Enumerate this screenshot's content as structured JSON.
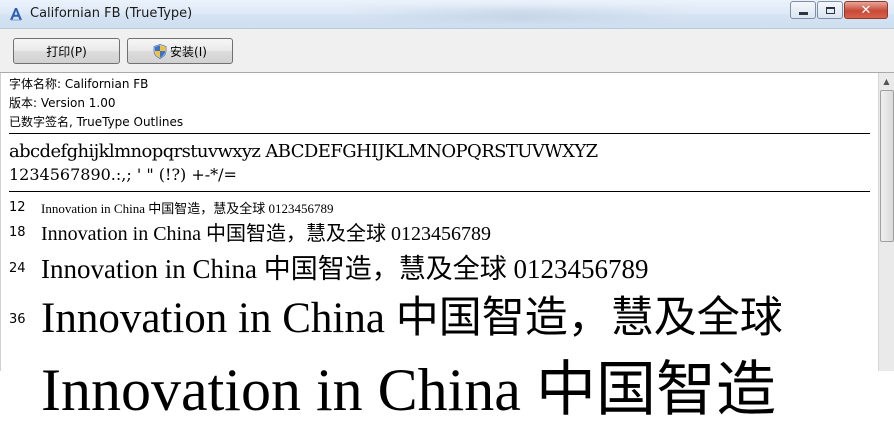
{
  "window": {
    "title": "Californian FB (TrueType)",
    "controls": {
      "minimize": "minimize-icon",
      "maximize": "maximize-icon",
      "close": "close-icon"
    }
  },
  "toolbar": {
    "print_label": "打印(P)",
    "install_label": "安装(I)",
    "install_icon": "shield-icon"
  },
  "info": {
    "font_name": "字体名称: Californian FB",
    "version": "版本: Version 1.00",
    "signature": "已数字签名, TrueType Outlines"
  },
  "charset": {
    "letters": "abcdefghijklmnopqrstuvwxyz ABCDEFGHIJKLMNOPQRSTUVWXYZ",
    "digits": "1234567890.:,; ' \" (!?) +-*/="
  },
  "samples": [
    {
      "size": "12",
      "text": "Innovation in China 中国智造，慧及全球 0123456789"
    },
    {
      "size": "18",
      "text": "Innovation in China 中国智造，慧及全球 0123456789"
    },
    {
      "size": "24",
      "text": "Innovation in China 中国智造，慧及全球 0123456789"
    },
    {
      "size": "36",
      "text": "Innovation in China 中国智造，慧及全球"
    },
    {
      "size": "",
      "text": "Innovation in China 中国智造"
    }
  ],
  "colors": {
    "titlebar": "#dfeaf7",
    "close_button": "#c74a36"
  }
}
